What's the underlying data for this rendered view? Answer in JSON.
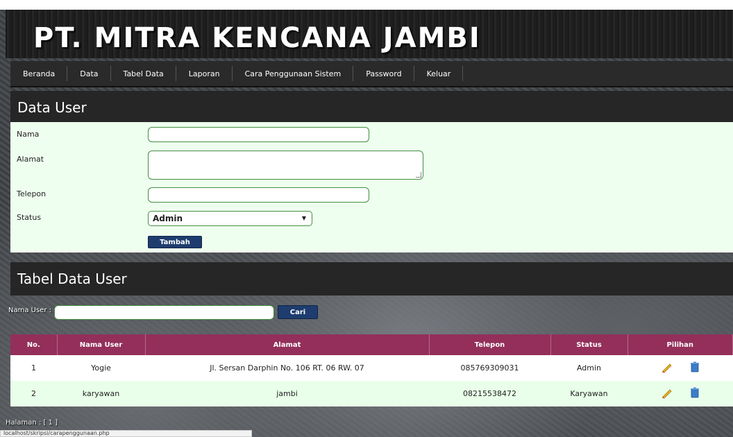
{
  "header": {
    "title": "PT. MITRA KENCANA JAMBI"
  },
  "nav": {
    "items": [
      {
        "label": "Beranda"
      },
      {
        "label": "Data"
      },
      {
        "label": "Tabel Data"
      },
      {
        "label": "Laporan"
      },
      {
        "label": "Cara Penggunaan Sistem"
      },
      {
        "label": "Password"
      },
      {
        "label": "Keluar"
      }
    ]
  },
  "form": {
    "heading": "Data User",
    "nama_label": "Nama",
    "alamat_label": "Alamat",
    "telepon_label": "Telepon",
    "status_label": "Status",
    "status_value": "Admin",
    "submit_label": "Tambah"
  },
  "table_section": {
    "heading": "Tabel Data User",
    "search_label": "Nama User :",
    "search_button": "Cari",
    "columns": [
      "No.",
      "Nama User",
      "Alamat",
      "Telepon",
      "Status",
      "Pilihan"
    ],
    "rows": [
      {
        "no": "1",
        "nama": "Yogie",
        "alamat": "Jl. Sersan Darphin No. 106 RT. 06 RW. 07",
        "telepon": "085769309031",
        "status": "Admin"
      },
      {
        "no": "2",
        "nama": "karyawan",
        "alamat": "jambi",
        "telepon": "08215538472",
        "status": "Karyawan"
      }
    ],
    "paging": "Halaman : [ 1 ]"
  },
  "browser": {
    "status_url": "localhost/skripsi/carapenggunaan.php"
  },
  "colors": {
    "table_header": "#932f5a",
    "button": "#1e3c6e",
    "form_bg": "#efffef"
  },
  "icons": {
    "edit": "pencil-icon",
    "delete": "trash-icon"
  }
}
